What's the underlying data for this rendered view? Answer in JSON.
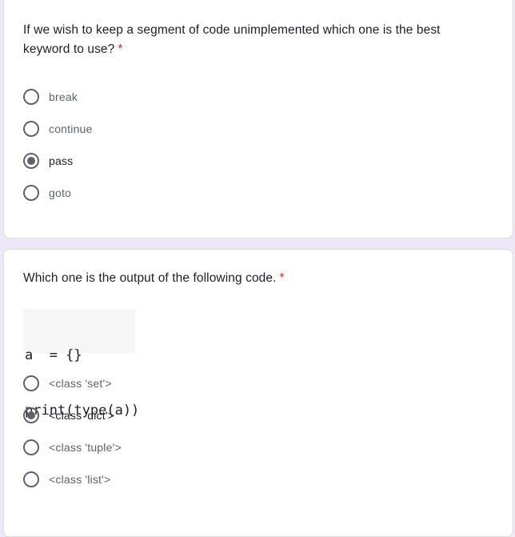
{
  "question1": {
    "text": "If we wish to keep a segment of code unimplemented which one is the best keyword to use?",
    "required_marker": "*",
    "options": [
      {
        "label": "break",
        "checked": false
      },
      {
        "label": "continue",
        "checked": false
      },
      {
        "label": "pass",
        "checked": true
      },
      {
        "label": "goto",
        "checked": false
      }
    ]
  },
  "question2": {
    "text": "Which one is the output of the following code.",
    "required_marker": "*",
    "code": {
      "line1": "a  = {}",
      "line2": "print(type(a))"
    },
    "options": [
      {
        "label": "<class 'set'>",
        "checked": false
      },
      {
        "label": "<class 'dict'>",
        "checked": true
      },
      {
        "label": "<class 'tuple'>",
        "checked": false
      },
      {
        "label": "<class 'list'>",
        "checked": false
      }
    ]
  },
  "colors": {
    "page_background": "#ede7f6",
    "required": "#d93025",
    "radio": "#5f6368"
  }
}
